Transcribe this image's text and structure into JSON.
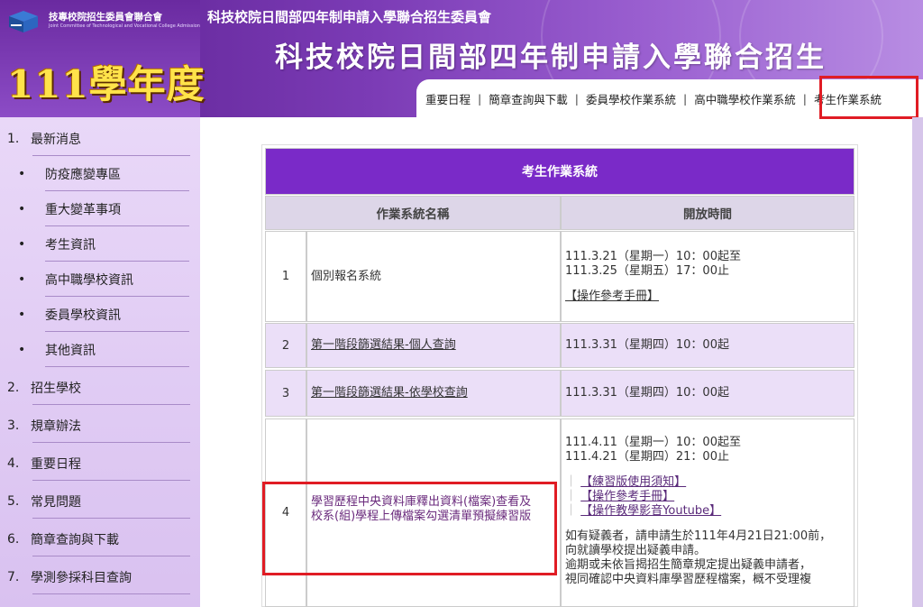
{
  "header": {
    "org_name": "技專校院招生委員會聯合會",
    "org_name_en": "Joint Committee of Technological and Vocational College Admission",
    "year_title": "111學年度",
    "sub_title": "科技校院日間部四年制申請入學聯合招生委員會",
    "main_title": "科技校院日間部四年制申請入學聯合招生",
    "nav": [
      "重要日程",
      "簡章查詢與下載",
      "委員學校作業系統",
      "高中職學校作業系統",
      "考生作業系統"
    ],
    "nav_sep": "|",
    "highlight_color": "#e01c24"
  },
  "sidebar": {
    "items": [
      {
        "type": "main",
        "num": "1.",
        "label": "最新消息"
      },
      {
        "type": "sub",
        "bullet": "•",
        "label": "防疫應變專區"
      },
      {
        "type": "sub",
        "bullet": "•",
        "label": "重大變革事項"
      },
      {
        "type": "sub",
        "bullet": "•",
        "label": "考生資訊"
      },
      {
        "type": "sub",
        "bullet": "•",
        "label": "高中職學校資訊"
      },
      {
        "type": "sub",
        "bullet": "•",
        "label": "委員學校資訊"
      },
      {
        "type": "sub",
        "bullet": "•",
        "label": "其他資訊"
      },
      {
        "type": "main",
        "num": "2.",
        "label": "招生學校"
      },
      {
        "type": "main",
        "num": "3.",
        "label": "規章辦法"
      },
      {
        "type": "main",
        "num": "4.",
        "label": "重要日程"
      },
      {
        "type": "main",
        "num": "5.",
        "label": "常見問題"
      },
      {
        "type": "main",
        "num": "6.",
        "label": "簡章查詢與下載"
      },
      {
        "type": "main",
        "num": "7.",
        "label": "學測參採科目查詢"
      }
    ]
  },
  "table": {
    "title": "考生作業系統",
    "headers": [
      "作業系統名稱",
      "開放時間"
    ],
    "rows": [
      {
        "num": "1",
        "name": "個別報名系統",
        "time_lines": [
          "111.3.21（星期一）10：00起至",
          "111.3.25（星期五）17：00止"
        ],
        "links": [
          "【操作參考手冊】"
        ]
      },
      {
        "num": "2",
        "name": "第一階段篩選結果-個人查詢",
        "time_lines": [
          "111.3.31（星期四）10：00起"
        ]
      },
      {
        "num": "3",
        "name": "第一階段篩選結果-依學校查詢",
        "time_lines": [
          "111.3.31（星期四）10：00起"
        ]
      },
      {
        "num": "4",
        "name_lines": [
          "學習歷程中央資料庫釋出資料(檔案)查看及",
          "校系(組)學程上傳檔案勾選清單預擬練習版"
        ],
        "time_lines": [
          "111.4.11（星期一）10：00起至",
          "111.4.21（星期四）21：00止"
        ],
        "links": [
          "【練習版使用須知】",
          "【操作參考手冊】",
          "【操作教學影音Youtube】"
        ],
        "link_prefix": "｜",
        "notes": [
          "如有疑義者，請申請生於111年4月21日21:00前，",
          "向就讀學校提出疑義申請。",
          "逾期或未依旨揭招生簡章規定提出疑義申請者，",
          "視同確認中央資料庫學習歷程檔案，概不受理複"
        ]
      }
    ]
  }
}
